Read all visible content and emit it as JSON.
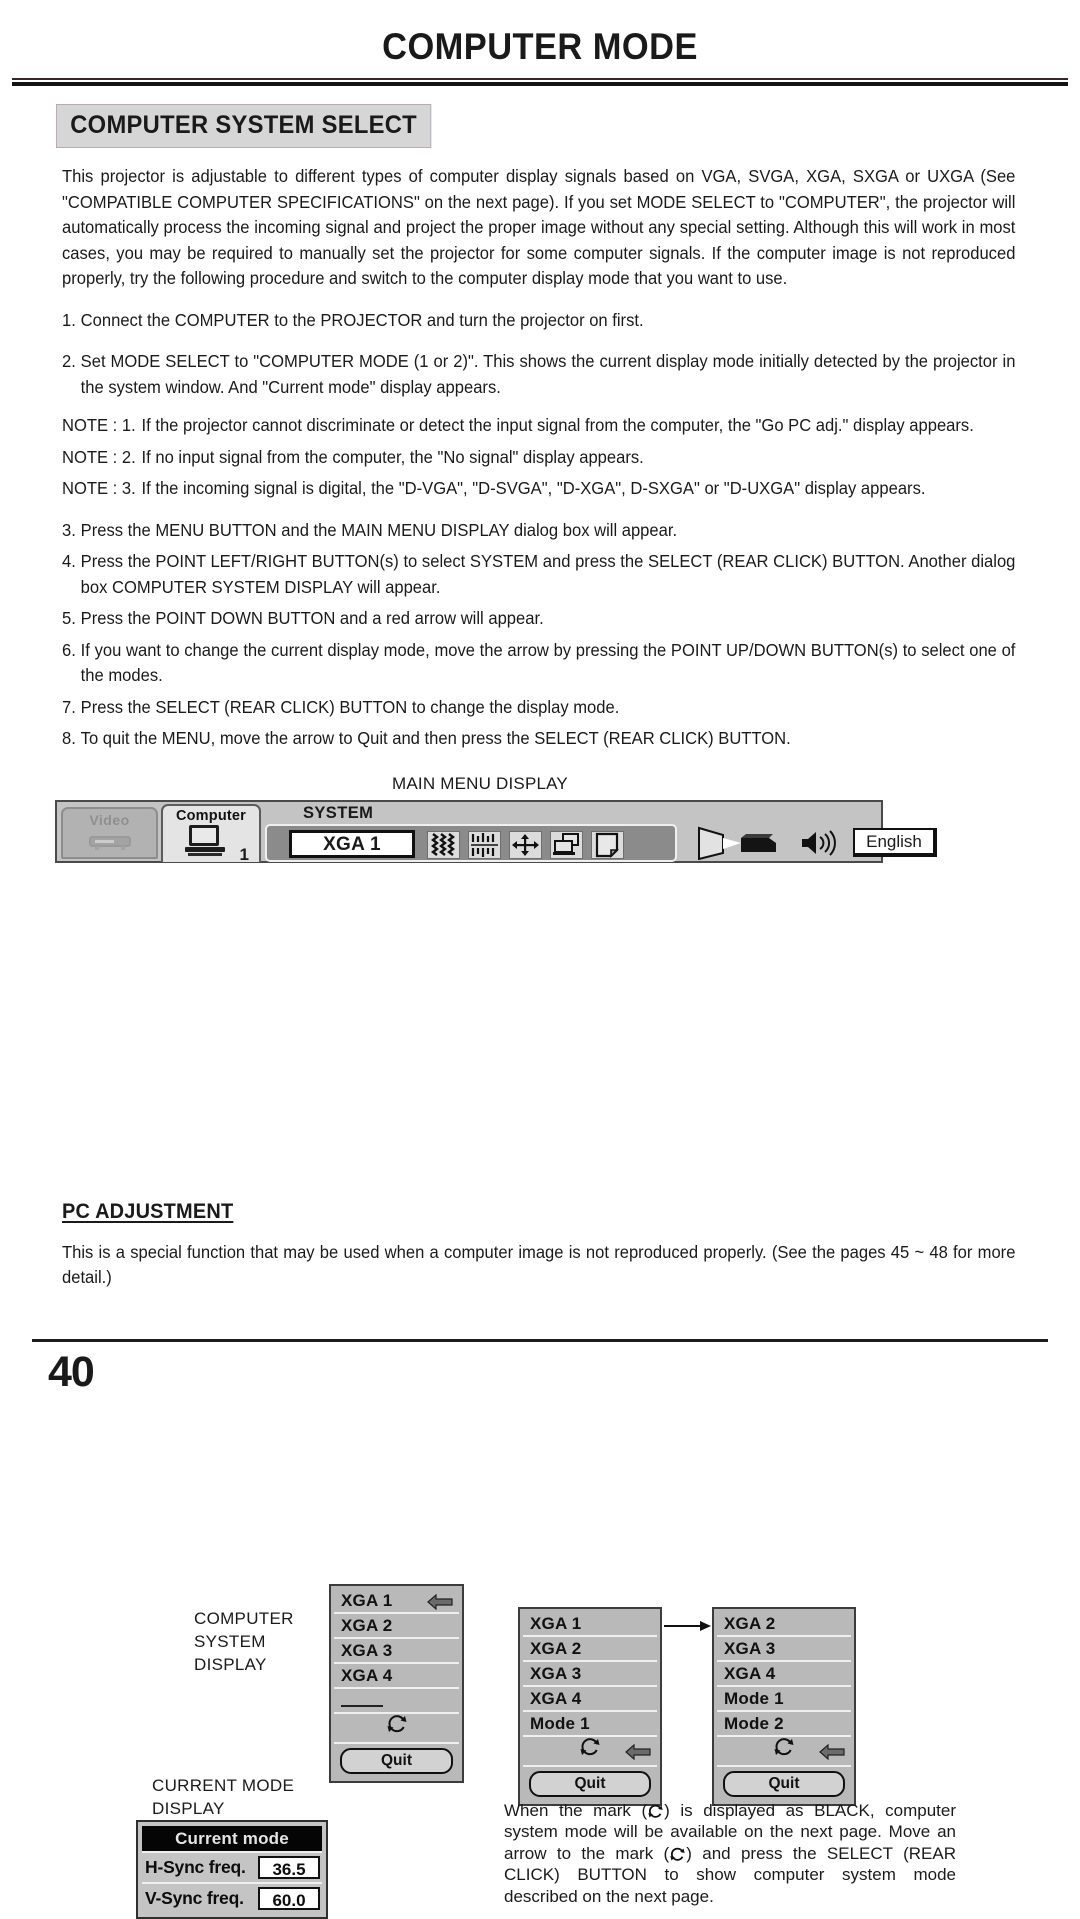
{
  "header": {
    "title": "COMPUTER MODE",
    "section_banner": "COMPUTER SYSTEM SELECT"
  },
  "intro": {
    "paragraph": "This projector is adjustable to different types of computer display signals based on VGA, SVGA, XGA, SXGA or UXGA (See \"COMPATIBLE COMPUTER SPECIFICATIONS\" on the next page). If you set MODE SELECT to \"COMPUTER\", the projector will automatically process the incoming signal and project the proper image without any special setting. Although this will work in most cases, you may be required to manually set the projector for some computer signals. If the computer image is not reproduced properly, try the following procedure and switch to the computer display mode that you want to use."
  },
  "steps": [
    {
      "num": "1.",
      "text": "Connect the COMPUTER to the PROJECTOR and turn the projector on first."
    },
    {
      "num": "2.",
      "text": "Set MODE SELECT to \"COMPUTER MODE (1 or 2)\". This shows the current display mode initially detected by the projector in the system window. And \"Current mode\" display appears."
    }
  ],
  "notes": [
    {
      "lead": "NOTE : 1.",
      "text": "If the projector cannot discriminate or detect the input signal from the computer, the \"Go PC adj.\" display appears."
    },
    {
      "lead": "NOTE : 2.",
      "text": "If no input signal from the computer, the \"No signal\" display appears."
    },
    {
      "lead": "NOTE : 3.",
      "text": "If the incoming signal is digital, the \"D-VGA\", \"D-SVGA\", \"D-XGA\", D-SXGA\" or \"D-UXGA\" display appears."
    }
  ],
  "steps2": [
    {
      "num": "3.",
      "text": "Press the MENU BUTTON and the MAIN MENU DISPLAY dialog box will appear."
    },
    {
      "num": "4.",
      "text": "Press the POINT LEFT/RIGHT BUTTON(s) to select SYSTEM and press the SELECT (REAR CLICK) BUTTON. Another dialog box COMPUTER SYSTEM DISPLAY will appear."
    },
    {
      "num": "5.",
      "text": "Press the POINT DOWN BUTTON and a red arrow will appear."
    },
    {
      "num": "6.",
      "text": "If you want to change the current display mode, move the arrow by pressing the POINT UP/DOWN BUTTON(s) to select one of the modes."
    },
    {
      "num": "7.",
      "text": "Press the SELECT (REAR CLICK) BUTTON to change the display mode."
    },
    {
      "num": "8.",
      "text": "To quit the MENU, move the arrow to Quit and then press the SELECT (REAR CLICK) BUTTON."
    }
  ],
  "figure": {
    "main_menu_caption": "MAIN MENU DISPLAY",
    "computer_system_display_label": "COMPUTER\nSYSTEM\nDISPLAY",
    "computer_system_display_label_lines": [
      "COMPUTER",
      "SYSTEM",
      "DISPLAY"
    ],
    "current_mode_display_label_lines": [
      "CURRENT MODE",
      "DISPLAY"
    ],
    "menubar": {
      "video_tab": "Video",
      "computer_tab": "Computer",
      "computer_tab_number": "1",
      "system_label": "SYSTEM",
      "selected_mode": "XGA 1",
      "language_button": "English",
      "icons": [
        "wave-contrast-icon",
        "bars-image-icon",
        "move-position-icon",
        "screen-window-icon",
        "page-setting-icon"
      ],
      "right_icons": [
        "projector-lamp-icon",
        "volume-speaker-icon"
      ]
    },
    "dialog_a": {
      "rows": [
        "XGA 1",
        "XGA 2",
        "XGA 3",
        "XGA 4"
      ],
      "dash_row": true,
      "mark_row": "refresh-mark-icon",
      "quit_label": "Quit",
      "arrow_on_row": 0
    },
    "dialog_b": {
      "rows": [
        "XGA 1",
        "XGA 2",
        "XGA 3",
        "XGA 4",
        "Mode 1"
      ],
      "mark_row": "refresh-mark-icon",
      "quit_label": "Quit",
      "arrow_on_mark_row": true
    },
    "dialog_c": {
      "rows": [
        "XGA 2",
        "XGA 3",
        "XGA 4",
        "Mode 1",
        "Mode 2"
      ],
      "mark_row": "refresh-mark-icon",
      "quit_label": "Quit",
      "arrow_on_mark_row": true
    },
    "current_mode": {
      "title": "Current mode",
      "rows": [
        {
          "key": "H-Sync freq.",
          "value": "36.5"
        },
        {
          "key": "V-Sync freq.",
          "value": "60.0"
        }
      ]
    },
    "mark_note": "When the mark (  ) is displayed as BLACK, computer system mode will be available on the next page. Move an arrow to the mark (  ) and press the SELECT (REAR CLICK) BUTTON to show computer system mode described on the next page.",
    "mark_note_parts": [
      "When the mark (",
      ") is displayed as BLACK, computer system mode will be available on the next page. Move an arrow to the mark (",
      ") and press the SELECT (REAR CLICK) BUTTON to show computer system mode described on the next page."
    ]
  },
  "pc_adjustment": {
    "heading": "PC ADJUSTMENT",
    "paragraph": "This is a special function that may be used when a computer image is not reproduced properly. (See the pages 45 ~ 48 for more detail.)"
  },
  "footer": {
    "page_number": "40"
  }
}
